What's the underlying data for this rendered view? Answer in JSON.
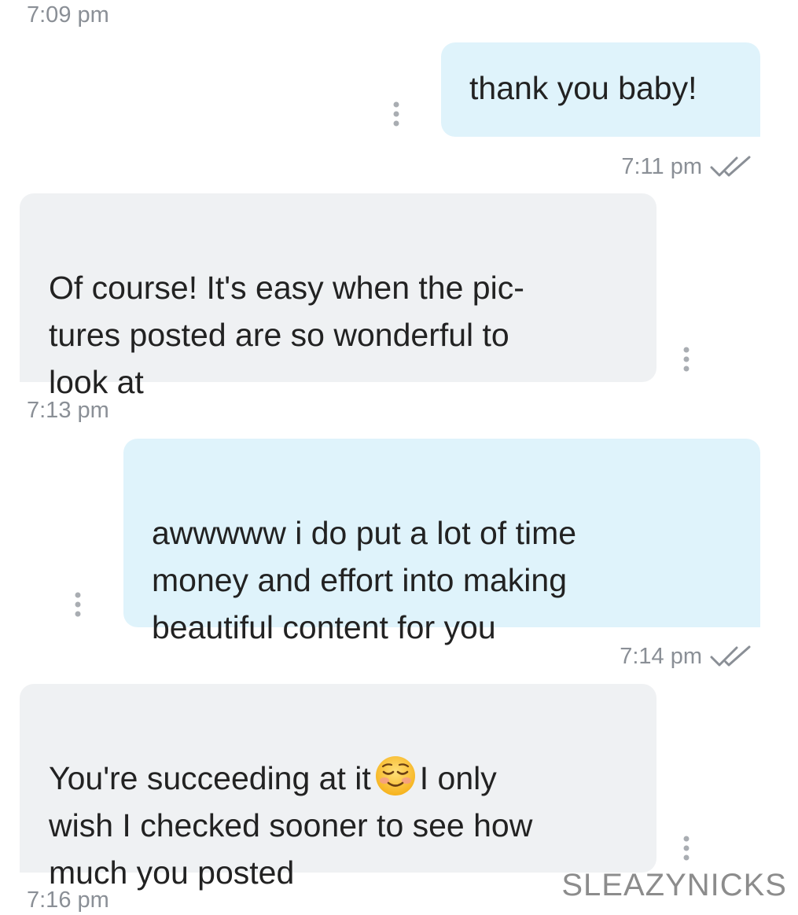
{
  "messages": [
    {
      "id": "m1",
      "direction": "outgoing",
      "text": "thank you baby!",
      "time_above": "7:09 pm",
      "time_below": "7:11 pm",
      "status_icon": "double-check-icon"
    },
    {
      "id": "m2",
      "direction": "incoming",
      "text": "Of course! It's easy when the pic-\ntures posted are so wonderful to\nlook at",
      "time_below": "7:13 pm"
    },
    {
      "id": "m3",
      "direction": "outgoing",
      "text": "awwwww i do put a lot of time\nmoney and effort into making\nbeautiful content for you",
      "time_below": "7:14 pm",
      "status_icon": "double-check-icon"
    },
    {
      "id": "m4",
      "direction": "incoming",
      "text_before_emoji": "You're succeeding at it",
      "emoji": "smiling-face-icon",
      "text_after_emoji": "I only\nwish I checked sooner to see how\nmuch you posted",
      "time_below": "7:16 pm"
    }
  ],
  "watermark": "SLEAZYNICKS",
  "colors": {
    "outgoing_bubble": "#dff3fb",
    "incoming_bubble": "#eff1f3",
    "timestamp": "#8a8f96",
    "text": "#222222"
  }
}
